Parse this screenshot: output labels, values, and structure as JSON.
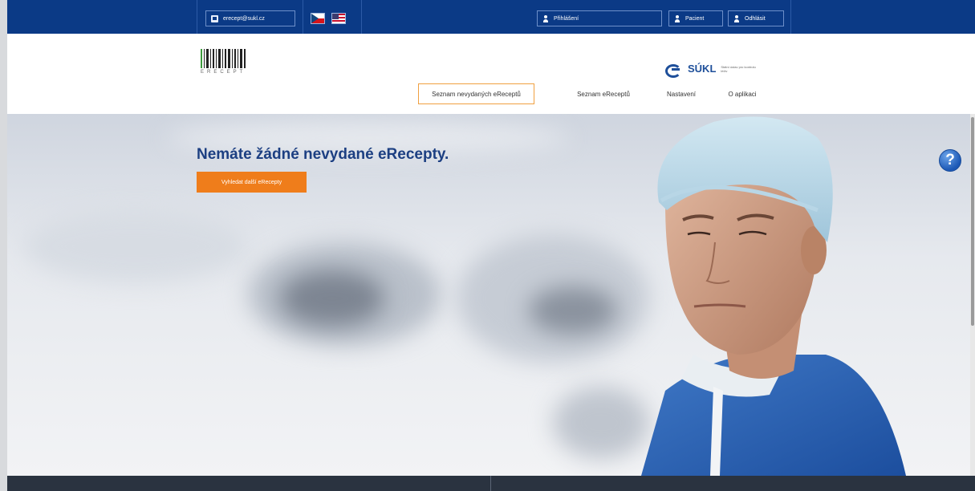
{
  "topbar": {
    "email": "erecept@sukl.cz",
    "language_cz": "CZ",
    "language_en": "EN",
    "login_label": "Přihlášení",
    "patient_label": "Pacient",
    "logout_label": "Odhlásit"
  },
  "header": {
    "logo_text": "ERECEPT",
    "authority_name": "SÚKL",
    "authority_subtitle": "Státní ústav pro kontrolu léčiv"
  },
  "nav": {
    "items": [
      {
        "label": "Seznam nevydaných eReceptů",
        "active": true
      },
      {
        "label": "Seznam eReceptů",
        "active": false
      },
      {
        "label": "Nastavení",
        "active": false
      },
      {
        "label": "O aplikaci",
        "active": false
      }
    ]
  },
  "hero": {
    "title": "Nemáte žádné nevydané eRecepty.",
    "search_button": "Vyhledat další eRecepty",
    "help_glyph": "?"
  },
  "colors": {
    "topbar": "#0b3a86",
    "accent": "#ef7d1b",
    "title": "#1c3f82",
    "footer": "#2a3340"
  }
}
